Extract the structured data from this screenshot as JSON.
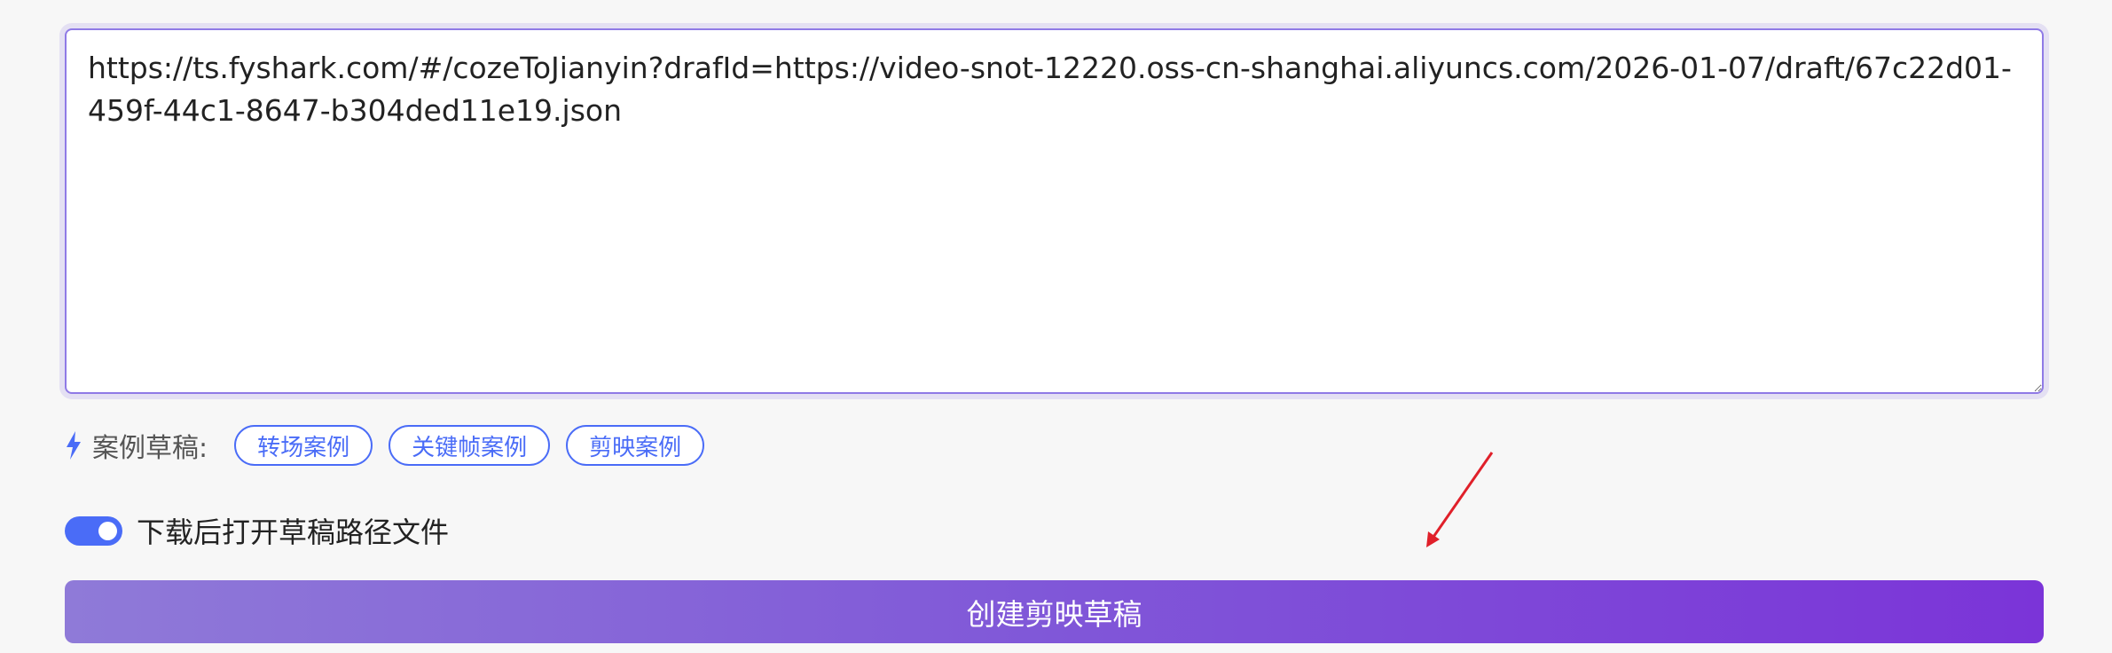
{
  "draft_input": {
    "value": "https://ts.fyshark.com/#/cozeToJianyin?drafId=https://video-snot-12220.oss-cn-shanghai.aliyuncs.com/2026-01-07/draft/67c22d01-459f-44c1-8647-b304ded11e19.json"
  },
  "examples": {
    "icon": "lightning-bolt-icon",
    "label": "案例草稿:",
    "tags": [
      {
        "label": "转场案例"
      },
      {
        "label": "关键帧案例"
      },
      {
        "label": "剪映案例"
      }
    ]
  },
  "open_after_download": {
    "label": "下载后打开草稿路径文件",
    "enabled": true
  },
  "create_button": {
    "label": "创建剪映草稿"
  },
  "colors": {
    "accent": "#4a6cf7",
    "button_gradient_start": "#8f7ad8",
    "button_gradient_end": "#7b34d8",
    "annotation_arrow": "#e0202a"
  }
}
